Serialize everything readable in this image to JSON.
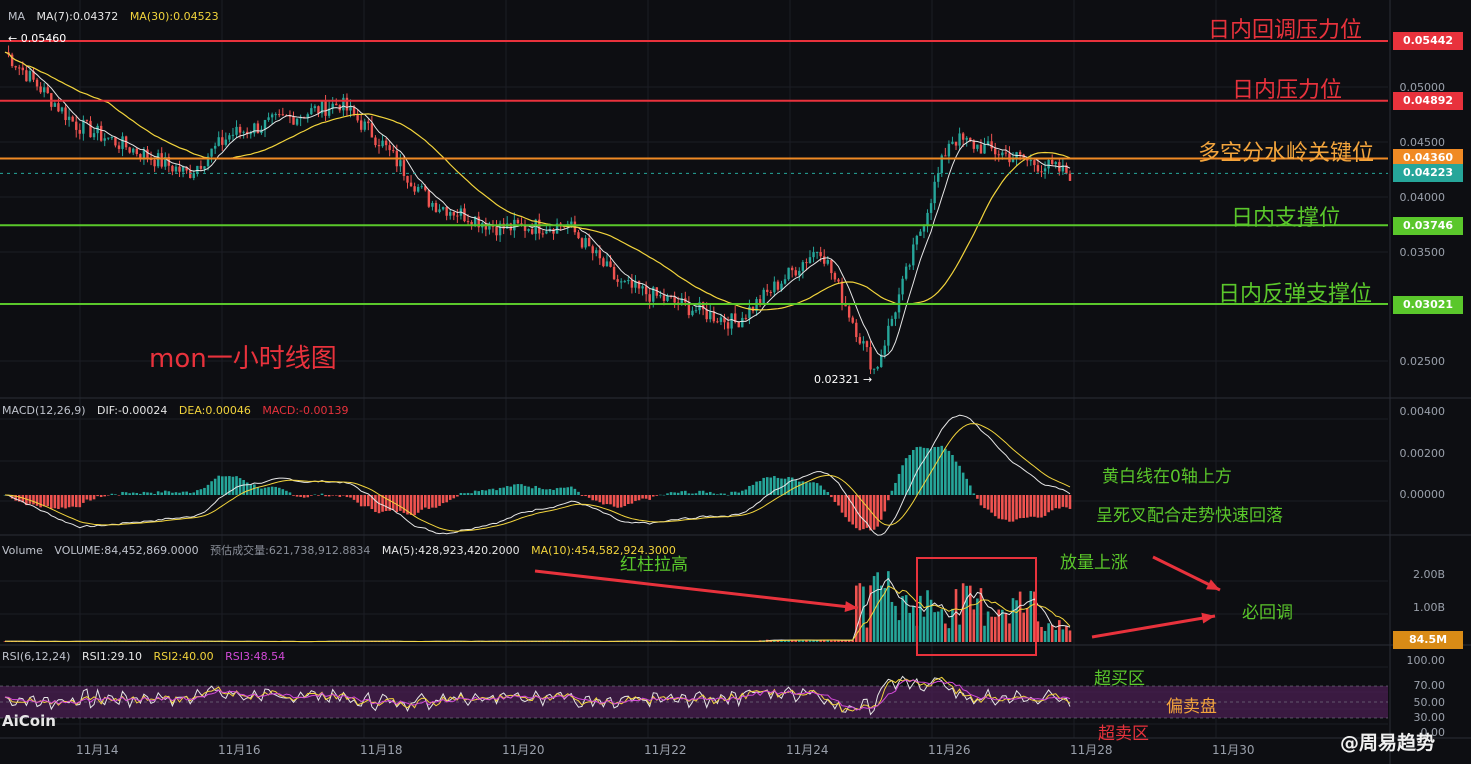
{
  "header": {
    "ma_label": "MA",
    "ma7": "MA(7):0.04372",
    "ma30": "MA(30):0.04523"
  },
  "main_chart": {
    "title_annotation": "mon一小时线图",
    "high_marker": "← 0.05460",
    "low_marker": "0.02321 →",
    "levels": [
      {
        "label": "日内回调压力位",
        "price": "0.05442",
        "value": 0.05442,
        "color": "#e8323c"
      },
      {
        "label": "日内压力位",
        "price": "0.04892",
        "value": 0.04892,
        "color": "#e8323c"
      },
      {
        "label": "多空分水岭关键位",
        "price": "0.04360",
        "value": 0.0436,
        "color": "#f08a24"
      },
      {
        "label": "日内支撑位",
        "price": "0.03746",
        "value": 0.03746,
        "color": "#5ac72b"
      },
      {
        "label": "日内反弹支撑位",
        "price": "0.03021",
        "value": 0.03021,
        "color": "#5ac72b"
      }
    ],
    "current_price": {
      "price": "0.04223",
      "value": 0.04223,
      "color": "#26a69a"
    },
    "y_ticks": [
      "0.05000",
      "0.04500",
      "0.04000",
      "0.03500",
      "0.02500"
    ]
  },
  "macd": {
    "label": "MACD(12,26,9)",
    "dif": "DIF:-0.00024",
    "dea": "DEA:0.00046",
    "macd": "MACD:-0.00139",
    "y_ticks": [
      "0.00400",
      "0.00200",
      "0.00000"
    ],
    "notes": [
      "黄白线在0轴上方",
      "呈死叉配合走势快速回落"
    ]
  },
  "volume": {
    "label": "Volume",
    "volume": "VOLUME:84,452,869.0000",
    "estimate": "预估成交量:621,738,912.8834",
    "ma5": "MA(5):428,923,420.2000",
    "ma10": "MA(10):454,582,924.3000",
    "y_ticks": [
      "2.00B",
      "1.00B"
    ],
    "current": "84.5M",
    "notes": {
      "red_bars": "红柱拉高",
      "rise": "放量上涨",
      "pullback": "必回调"
    }
  },
  "rsi": {
    "label": "RSI(6,12,24)",
    "rsi1": "RSI1:29.10",
    "rsi2": "RSI2:40.00",
    "rsi3": "RSI3:48.54",
    "y_ticks": [
      "100.00",
      "70.00",
      "50.00",
      "30.00",
      "0.00"
    ],
    "zones": {
      "overbought": "超买区",
      "neutral": "偏卖盘",
      "oversold": "超卖区"
    }
  },
  "x_axis": [
    "11月14",
    "11月16",
    "11月18",
    "11月20",
    "11月22",
    "11月24",
    "11月26",
    "11月28",
    "11月30"
  ],
  "branding": {
    "aicoin": "AiCoin",
    "watermark": "@周易趋势"
  },
  "chart_data": {
    "type": "candlestick",
    "title": "mon一小时线图",
    "x_range": [
      "11月13",
      "11月27"
    ],
    "price_points": [
      {
        "x": "11月13",
        "y": 0.0534
      },
      {
        "x": "11月14",
        "y": 0.0468
      },
      {
        "x": "11月15",
        "y": 0.0422
      },
      {
        "x": "11月16",
        "y": 0.0458
      },
      {
        "x": "11月17",
        "y": 0.0487
      },
      {
        "x": "11月18",
        "y": 0.0452
      },
      {
        "x": "11月19",
        "y": 0.0396
      },
      {
        "x": "11月20",
        "y": 0.0372
      },
      {
        "x": "11月21",
        "y": 0.0375
      },
      {
        "x": "11月22",
        "y": 0.032
      },
      {
        "x": "11月23",
        "y": 0.0285
      },
      {
        "x": "11月24",
        "y": 0.0355
      },
      {
        "x": "11月25",
        "y": 0.024
      },
      {
        "x": "11月26",
        "y": 0.0455
      },
      {
        "x": "11月27",
        "y": 0.0422
      }
    ],
    "ylim": [
      0.022,
      0.056
    ]
  }
}
